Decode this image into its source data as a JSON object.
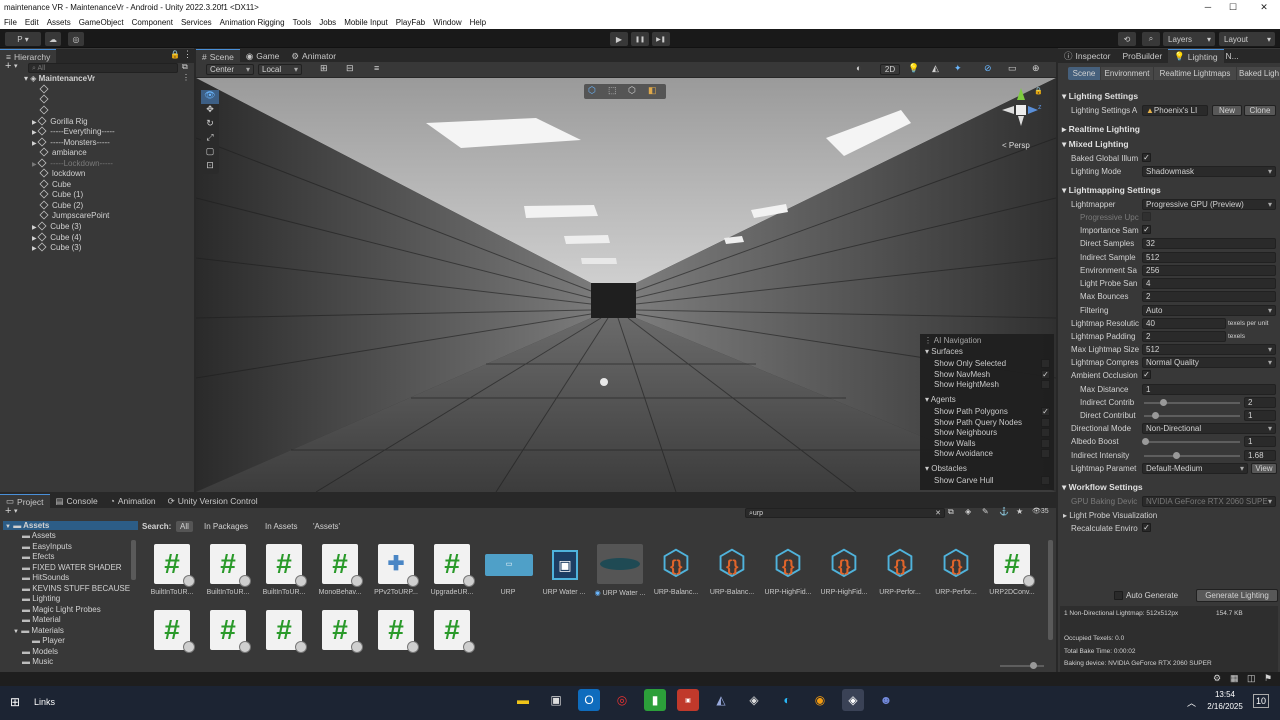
{
  "window": {
    "title": "maintenance VR - MaintenanceVr - Android - Unity 2022.3.20f1 <DX11>",
    "minimize": "─",
    "maximize": "☐",
    "close": "✕"
  },
  "menu": [
    "File",
    "Edit",
    "Assets",
    "GameObject",
    "Component",
    "Services",
    "Animation Rigging",
    "Tools",
    "Jobs",
    "Mobile Input",
    "PlayFab",
    "Window",
    "Help"
  ],
  "toolbar": {
    "account": "P ▾",
    "layers": "Layers",
    "layout": "Layout",
    "play": "▶",
    "pause": "❚❚",
    "step": "▶❚"
  },
  "hierarchy": {
    "tab": "Hierarchy",
    "search_placeholder": "All",
    "root": "MaintenanceVr",
    "items": [
      "",
      "",
      "",
      "Gorilla Rig",
      "-----Everything-----",
      "-----Monsters-----",
      "ambiance",
      "-----Lockdown-----",
      "lockdown",
      "Cube",
      "Cube (1)",
      "Cube (2)",
      "JumpscarePoint",
      "Cube (3)",
      "Cube (4)",
      "Cube (3)"
    ]
  },
  "scene": {
    "tabs": [
      "Scene",
      "Game",
      "Animator"
    ],
    "pivot": "Center",
    "space": "Local",
    "mode_2d": "2D",
    "persp": "< Persp",
    "overlay": {
      "title": "AI Navigation",
      "surfaces": "Surfaces",
      "show_only_selected": "Show Only Selected",
      "show_navmesh": "Show NavMesh",
      "show_heightmesh": "Show HeightMesh",
      "agents": "Agents",
      "show_path_polygons": "Show Path Polygons",
      "show_path_query_nodes": "Show Path Query Nodes",
      "show_neighbours": "Show Neighbours",
      "show_walls": "Show Walls",
      "show_avoidance": "Show Avoidance",
      "obstacles": "Obstacles",
      "show_carve_hull": "Show Carve Hull"
    }
  },
  "inspector_tabs": [
    "Inspector",
    "ProBuilder",
    "Lighting",
    "N..."
  ],
  "lighting": {
    "subtabs": [
      "Scene",
      "Environment",
      "Realtime Lightmaps",
      "Baked Ligh"
    ],
    "lighting_settings": "Lighting Settings",
    "lighting_settings_asset_label": "Lighting Settings A",
    "asset_name": "Phoenix's LI",
    "new": "New",
    "clone": "Clone",
    "realtime_lighting": "Realtime Lighting",
    "mixed_lighting": "Mixed Lighting",
    "baked_gi": "Baked Global Illum",
    "lighting_mode_label": "Lighting Mode",
    "lighting_mode": "Shadowmask",
    "lightmapping_settings": "Lightmapping Settings",
    "lightmapper_label": "Lightmapper",
    "lightmapper": "Progressive GPU (Preview)",
    "progressive_updates": "Progressive Upc",
    "importance_sampling": "Importance Sam",
    "direct_samples_label": "Direct Samples",
    "direct_samples": "32",
    "indirect_samples_label": "Indirect Sample",
    "indirect_samples": "512",
    "environment_samples_label": "Environment Sa",
    "environment_samples": "256",
    "light_probe_label": "Light Probe San",
    "light_probe": "4",
    "max_bounces_label": "Max Bounces",
    "max_bounces": "2",
    "filtering_label": "Filtering",
    "filtering": "Auto",
    "lightmap_resolution_label": "Lightmap Resolutic",
    "lightmap_resolution": "40",
    "texels_per_unit": "texels per unit",
    "lightmap_padding_label": "Lightmap Padding",
    "lightmap_padding": "2",
    "texels": "texels",
    "max_lightmap_size_label": "Max Lightmap Size",
    "max_lightmap_size": "512",
    "lightmap_compression_label": "Lightmap Compres",
    "lightmap_compression": "Normal Quality",
    "ambient_occlusion_label": "Ambient Occlusion",
    "max_distance_label": "Max Distance",
    "max_distance": "1",
    "indirect_contribution_label": "Indirect Contrib",
    "indirect_contribution": "2",
    "direct_contribution_label": "Direct Contribut",
    "direct_contribution": "1",
    "directional_mode_label": "Directional Mode",
    "directional_mode": "Non-Directional",
    "albedo_boost_label": "Albedo Boost",
    "albedo_boost": "1",
    "indirect_intensity_label": "Indirect Intensity",
    "indirect_intensity": "1.68",
    "lightmap_params_label": "Lightmap Paramet",
    "lightmap_params": "Default-Medium",
    "view": "View",
    "workflow_settings": "Workflow Settings",
    "gpu_baking_device_label": "GPU Baking Devic",
    "gpu_baking_device": "NVIDIA GeForce RTX 2060 SUPE",
    "light_probe_vis": "Light Probe Visualization",
    "recalculate_env": "Recalculate Enviro",
    "auto_generate": "Auto Generate",
    "generate_lighting": "Generate Lighting",
    "stats_lightmaps": "1 Non-Directional Lightmap: 512x512px",
    "stats_size": "154.7 KB",
    "occupied_texels": "Occupied Texels: 0.0",
    "total_bake_time": "Total Bake Time: 0:00:02",
    "baking_device": "Baking device: NVIDIA GeForce RTX 2060 SUPER"
  },
  "project": {
    "tabs": [
      "Project",
      "Console",
      "Animation",
      "Unity Version Control"
    ],
    "search_value": "urp",
    "search_label": "Search:",
    "filters": [
      "All",
      "In Packages",
      "In Assets",
      "'Assets'"
    ],
    "count": "35",
    "tree": [
      {
        "label": "Assets",
        "level": 0,
        "bold": true
      },
      {
        "label": "Assets",
        "level": 1
      },
      {
        "label": "EasyInputs",
        "level": 1
      },
      {
        "label": "Efects",
        "level": 1
      },
      {
        "label": "FIXED WATER SHADER",
        "level": 1
      },
      {
        "label": "HitSounds",
        "level": 1
      },
      {
        "label": "KEVINS STUFF BECAUSE",
        "level": 1
      },
      {
        "label": "Lighting",
        "level": 1
      },
      {
        "label": "Magic Light Probes",
        "level": 1
      },
      {
        "label": "Material",
        "level": 1
      },
      {
        "label": "Materials",
        "level": 1
      },
      {
        "label": "Player",
        "level": 2
      },
      {
        "label": "Models",
        "level": 1
      },
      {
        "label": "Music",
        "level": 1
      }
    ],
    "assets_row1": [
      {
        "label": "BuiltInToUR...",
        "kind": "script"
      },
      {
        "label": "BuiltInToUR...",
        "kind": "script"
      },
      {
        "label": "BuiltInToUR...",
        "kind": "script"
      },
      {
        "label": "MonoBehav...",
        "kind": "script"
      },
      {
        "label": "PPv2ToURP...",
        "kind": "puzzle"
      },
      {
        "label": "UpgradeUR...",
        "kind": "script"
      },
      {
        "label": "URP",
        "kind": "pipeline"
      },
      {
        "label": "URP Water ...",
        "kind": "render"
      },
      {
        "label": "URP Water ...",
        "kind": "material"
      },
      {
        "label": "URP-Balanc...",
        "kind": "shader"
      },
      {
        "label": "URP-Balanc...",
        "kind": "shader"
      },
      {
        "label": "URP-HighFid...",
        "kind": "shader"
      },
      {
        "label": "URP-HighFid...",
        "kind": "shader"
      },
      {
        "label": "URP-Perfor...",
        "kind": "shader"
      },
      {
        "label": "URP-Perfor...",
        "kind": "shader"
      },
      {
        "label": "URP2DConv...",
        "kind": "script"
      }
    ],
    "assets_row2": [
      {
        "label": "",
        "kind": "script"
      },
      {
        "label": "",
        "kind": "script"
      },
      {
        "label": "",
        "kind": "script"
      },
      {
        "label": "",
        "kind": "script"
      },
      {
        "label": "",
        "kind": "script"
      },
      {
        "label": "",
        "kind": "script"
      }
    ]
  },
  "taskbar": {
    "start": "Links",
    "time": "13:54",
    "date": "2/16/2025",
    "notif": "10"
  },
  "colors": {
    "accent": "#4a90d9",
    "panel": "#383838",
    "dark": "#282828",
    "script_green": "#2a9a2a",
    "shader_blue": "#4fb3dc",
    "shader_brace": "#e0642a"
  }
}
